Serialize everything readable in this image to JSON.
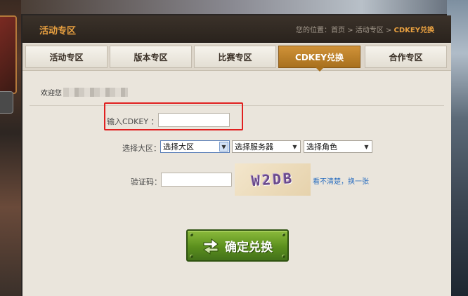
{
  "header": {
    "title": "活动专区",
    "breadcrumb": {
      "prefix": "您的位置：",
      "home": "首页",
      "sep": " > ",
      "section": "活动专区",
      "current": "CDKEY兑换"
    }
  },
  "tabs": [
    {
      "label": "活动专区",
      "active": false
    },
    {
      "label": "版本专区",
      "active": false
    },
    {
      "label": "比赛专区",
      "active": false
    },
    {
      "label": "CDKEY兑换",
      "active": true
    },
    {
      "label": "合作专区",
      "active": false
    }
  ],
  "welcome": {
    "text": "欢迎您"
  },
  "form": {
    "cdkey_label": "输入CDKEY ：",
    "cdkey_value": "",
    "region_label": "选择大区：",
    "region_select": "选择大区",
    "server_select": "选择服务器",
    "role_select": "选择角色",
    "captcha_label": "验证码：",
    "captcha_value": "",
    "captcha_image_text": "W2DB",
    "refresh_link": "看不清楚，换一张",
    "submit_label": "确定兑换"
  },
  "colors": {
    "accent": "#e8a040",
    "tab_active": "#c0842c",
    "highlight": "#e02020",
    "submit": "#5b8f1d",
    "link": "#2a6ec0"
  }
}
